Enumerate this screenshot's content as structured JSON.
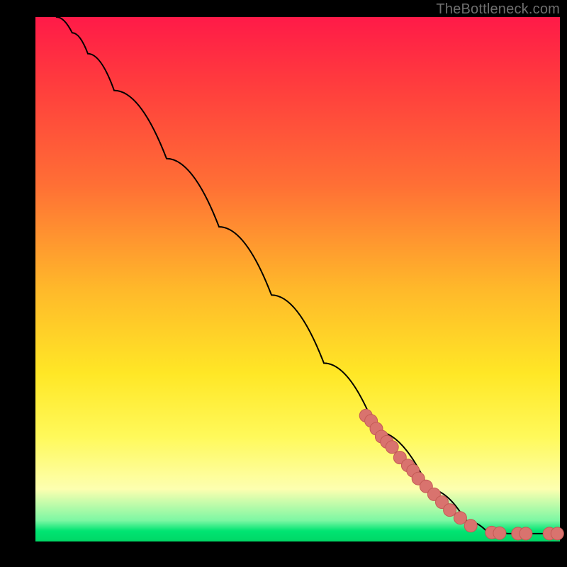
{
  "attribution": "TheBottleneck.com",
  "colors": {
    "frame_bg": "#000000",
    "gradient_top": "#ff1a48",
    "gradient_mid": "#ffe726",
    "gradient_bottom": "#00d766",
    "curve_stroke": "#000000",
    "marker_fill": "#d9736e",
    "marker_stroke": "#c45a55"
  },
  "chart_data": {
    "type": "line",
    "title": "",
    "xlabel": "",
    "ylabel": "",
    "xlim": [
      0,
      100
    ],
    "ylim": [
      0,
      100
    ],
    "curve": [
      {
        "x": 4,
        "y": 100
      },
      {
        "x": 7,
        "y": 97
      },
      {
        "x": 10,
        "y": 93
      },
      {
        "x": 15,
        "y": 86
      },
      {
        "x": 25,
        "y": 73
      },
      {
        "x": 35,
        "y": 60
      },
      {
        "x": 45,
        "y": 47
      },
      {
        "x": 55,
        "y": 34
      },
      {
        "x": 65,
        "y": 21
      },
      {
        "x": 75,
        "y": 10
      },
      {
        "x": 82,
        "y": 4
      },
      {
        "x": 86,
        "y": 2
      },
      {
        "x": 90,
        "y": 1.5
      },
      {
        "x": 100,
        "y": 1.5
      }
    ],
    "markers": [
      {
        "x": 63,
        "y": 24
      },
      {
        "x": 64,
        "y": 23
      },
      {
        "x": 65,
        "y": 21.5
      },
      {
        "x": 66,
        "y": 20
      },
      {
        "x": 67,
        "y": 19
      },
      {
        "x": 68,
        "y": 18
      },
      {
        "x": 69.5,
        "y": 16
      },
      {
        "x": 71,
        "y": 14.5
      },
      {
        "x": 72,
        "y": 13.5
      },
      {
        "x": 73,
        "y": 12
      },
      {
        "x": 74.5,
        "y": 10.5
      },
      {
        "x": 76,
        "y": 9
      },
      {
        "x": 77.5,
        "y": 7.5
      },
      {
        "x": 79,
        "y": 6
      },
      {
        "x": 81,
        "y": 4.5
      },
      {
        "x": 83,
        "y": 3
      },
      {
        "x": 87,
        "y": 1.7
      },
      {
        "x": 88.5,
        "y": 1.6
      },
      {
        "x": 92,
        "y": 1.5
      },
      {
        "x": 93.5,
        "y": 1.5
      },
      {
        "x": 98,
        "y": 1.5
      },
      {
        "x": 99.5,
        "y": 1.5
      }
    ]
  }
}
